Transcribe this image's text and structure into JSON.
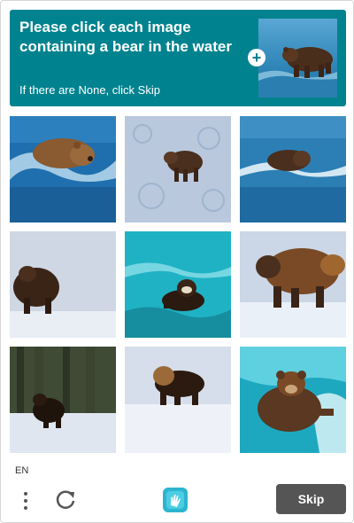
{
  "header": {
    "prompt": "Please click each image containing a bear in the water",
    "skip_hint": "If there are None, click Skip",
    "example_icon": "plus-icon"
  },
  "grid": {
    "tiles": [
      {
        "id": 1,
        "scene": "bear swimming in ocean wave"
      },
      {
        "id": 2,
        "scene": "bear walking on icy ground"
      },
      {
        "id": 3,
        "scene": "bear in water with splash"
      },
      {
        "id": 4,
        "scene": "bear standing on snow"
      },
      {
        "id": 5,
        "scene": "bear in turquoise water"
      },
      {
        "id": 6,
        "scene": "bear walking on snow"
      },
      {
        "id": 7,
        "scene": "bear on snowy forest edge"
      },
      {
        "id": 8,
        "scene": "bear walking on snow"
      },
      {
        "id": 9,
        "scene": "bear swimming in turquoise water"
      }
    ]
  },
  "footer": {
    "language": "EN",
    "menu_icon": "more-vertical-icon",
    "refresh_icon": "refresh-icon",
    "logo_icon": "hcaptcha-logo-icon",
    "skip_label": "Skip"
  },
  "colors": {
    "header_bg": "#00838f",
    "skip_button_bg": "#555555"
  }
}
